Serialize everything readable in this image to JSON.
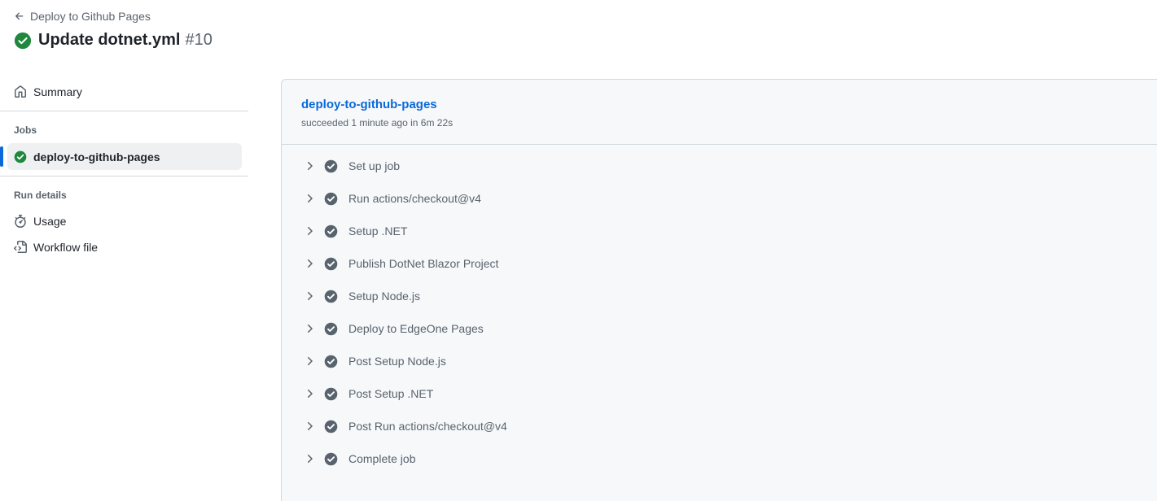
{
  "header": {
    "back_label": "Deploy to Github Pages",
    "title": "Update dotnet.yml",
    "run_number": "#10"
  },
  "sidebar": {
    "summary_label": "Summary",
    "jobs_heading": "Jobs",
    "jobs": [
      {
        "label": "deploy-to-github-pages"
      }
    ],
    "run_details_heading": "Run details",
    "usage_label": "Usage",
    "workflow_file_label": "Workflow file"
  },
  "job": {
    "name": "deploy-to-github-pages",
    "status": "succeeded 1 minute ago in 6m 22s",
    "steps": [
      {
        "label": "Set up job"
      },
      {
        "label": "Run actions/checkout@v4"
      },
      {
        "label": "Setup .NET"
      },
      {
        "label": "Publish DotNet Blazor Project"
      },
      {
        "label": "Setup Node.js"
      },
      {
        "label": "Deploy to EdgeOne Pages"
      },
      {
        "label": "Post Setup Node.js"
      },
      {
        "label": "Post Setup .NET"
      },
      {
        "label": "Post Run actions/checkout@v4"
      },
      {
        "label": "Complete job"
      }
    ]
  },
  "colors": {
    "success": "#1f883d",
    "step_check": "#59636e",
    "link": "#0969da",
    "active_bar": "#0969da"
  },
  "icons": {
    "back": "arrow-left-icon",
    "run_status": "check-circle-fill-icon",
    "summary": "home-icon",
    "job_status": "check-circle-fill-icon",
    "usage": "stopwatch-icon",
    "workflow_file": "file-code-icon",
    "step_expand": "chevron-right-icon",
    "step_status": "check-circle-fill-icon"
  }
}
